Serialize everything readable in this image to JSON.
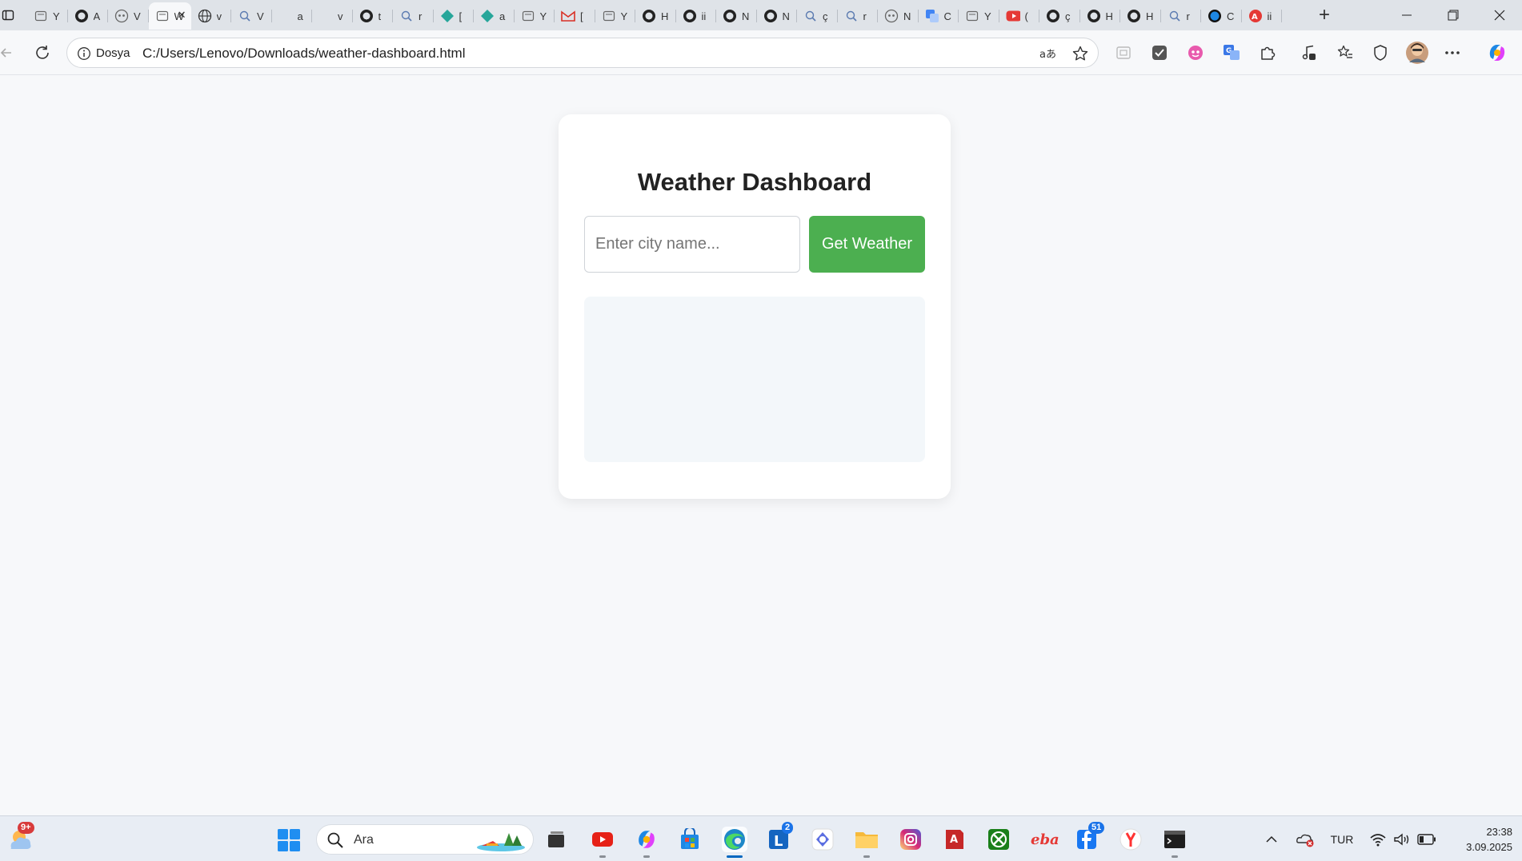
{
  "browser": {
    "tabs": [
      {
        "icon": "page-icon",
        "title": "Y"
      },
      {
        "icon": "github-icon",
        "title": "A"
      },
      {
        "icon": "copilot-icon",
        "title": "V"
      },
      {
        "icon": "page-icon",
        "title": "W",
        "active": true
      },
      {
        "icon": "globe-icon",
        "title": "v"
      },
      {
        "icon": "search-icon",
        "title": "V"
      },
      {
        "icon": "blank-icon",
        "title": "a"
      },
      {
        "icon": "blank-icon",
        "title": "v"
      },
      {
        "icon": "github-icon",
        "title": "t"
      },
      {
        "icon": "search-icon",
        "title": "r"
      },
      {
        "icon": "diamond-icon",
        "title": "["
      },
      {
        "icon": "diamond-icon",
        "title": "a"
      },
      {
        "icon": "page-icon",
        "title": "Y"
      },
      {
        "icon": "gmail-icon",
        "title": "["
      },
      {
        "icon": "page-icon",
        "title": "Y"
      },
      {
        "icon": "github-icon",
        "title": "H"
      },
      {
        "icon": "github-icon",
        "title": "ii"
      },
      {
        "icon": "github-icon",
        "title": "N"
      },
      {
        "icon": "github-icon",
        "title": "N"
      },
      {
        "icon": "search-icon",
        "title": "ç"
      },
      {
        "icon": "search-icon",
        "title": "r"
      },
      {
        "icon": "copilot-icon",
        "title": "N"
      },
      {
        "icon": "translate-icon",
        "title": "C"
      },
      {
        "icon": "page-icon",
        "title": "Y"
      },
      {
        "icon": "youtube-icon",
        "title": "("
      },
      {
        "icon": "github-icon",
        "title": "ç"
      },
      {
        "icon": "github-icon",
        "title": "H"
      },
      {
        "icon": "github-icon",
        "title": "H"
      },
      {
        "icon": "search-icon",
        "title": "r"
      },
      {
        "icon": "circle-icon",
        "title": "C"
      },
      {
        "icon": "adblock-icon",
        "title": "ii"
      }
    ],
    "new_tab": "+",
    "site_label": "Dosya",
    "url": "C:/Users/Lenovo/Downloads/weather-dashboard.html"
  },
  "page": {
    "title": "Weather Dashboard",
    "city_placeholder": "Enter city name...",
    "city_value": "",
    "button_label": "Get Weather",
    "accent_color": "#4caf50"
  },
  "taskbar": {
    "weather_badge": "9+",
    "search_label": "Ara",
    "lists_badge": "2",
    "messenger_badge": "51",
    "language": "TUR",
    "time": "23:38",
    "date": "3.09.2025"
  }
}
